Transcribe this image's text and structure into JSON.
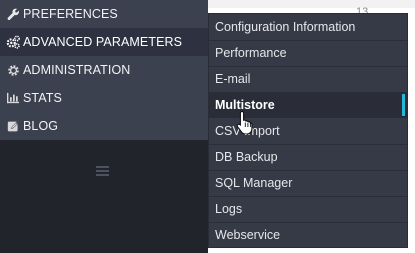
{
  "sidebar": {
    "items": [
      {
        "label": "PREFERENCES",
        "icon": "wrench-icon"
      },
      {
        "label": "ADVANCED PARAMETERS",
        "icon": "gears-icon"
      },
      {
        "label": "ADMINISTRATION",
        "icon": "gear-icon"
      },
      {
        "label": "STATS",
        "icon": "bar-chart-icon"
      },
      {
        "label": "BLOG",
        "icon": "edit-icon"
      }
    ],
    "collapse_icon": "hamburger-icon"
  },
  "submenu": {
    "items": [
      {
        "label": "Configuration Information"
      },
      {
        "label": "Performance"
      },
      {
        "label": "E-mail"
      },
      {
        "label": "Multistore",
        "active": true
      },
      {
        "label": "CSV Import"
      },
      {
        "label": "DB Backup"
      },
      {
        "label": "SQL Manager"
      },
      {
        "label": "Logs"
      },
      {
        "label": "Webservice"
      }
    ]
  },
  "background": {
    "fragment": "13"
  },
  "colors": {
    "accent": "#25b9d7",
    "sidebar": "#3c4150",
    "submenu": "#363a46"
  },
  "cursor": {
    "icon": "hand-pointer-icon"
  }
}
